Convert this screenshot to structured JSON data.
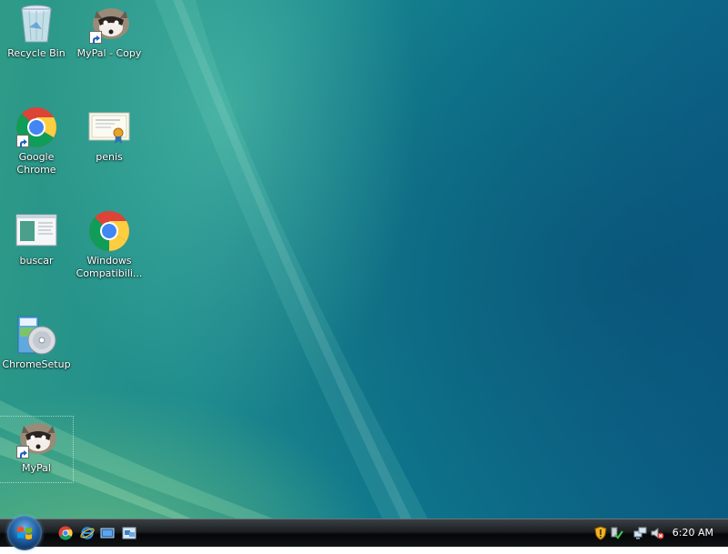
{
  "desktop": {
    "icons": [
      {
        "label": "Recycle Bin",
        "icon": "recycle-bin-icon"
      },
      {
        "label": "MyPal - Copy",
        "icon": "mypal-raccoon-icon"
      },
      {
        "label": "Google Chrome",
        "icon": "chrome-icon"
      },
      {
        "label": "penis",
        "icon": "certificate-icon"
      },
      {
        "label": "buscar",
        "icon": "window-app-icon"
      },
      {
        "label": "Windows Compatibili...",
        "icon": "chrome-icon"
      },
      {
        "label": "ChromeSetup",
        "icon": "setup-installer-icon"
      },
      {
        "label": "MyPal",
        "icon": "mypal-raccoon-icon"
      }
    ]
  },
  "taskbar": {
    "start_button": "start-orb-icon",
    "quick_launch": [
      "chrome-icon",
      "internet-explorer-icon",
      "show-desktop-icon",
      "switch-windows-icon"
    ],
    "tray": [
      "shield-warning-icon",
      "safely-remove-icon",
      "network-icon",
      "volume-muted-icon"
    ],
    "clock": "6:20 AM"
  },
  "colors": {
    "desktop_teal": "#1f8c8d",
    "taskbar_black": "#050607",
    "start_orb_blue": "#1e5fa3"
  }
}
